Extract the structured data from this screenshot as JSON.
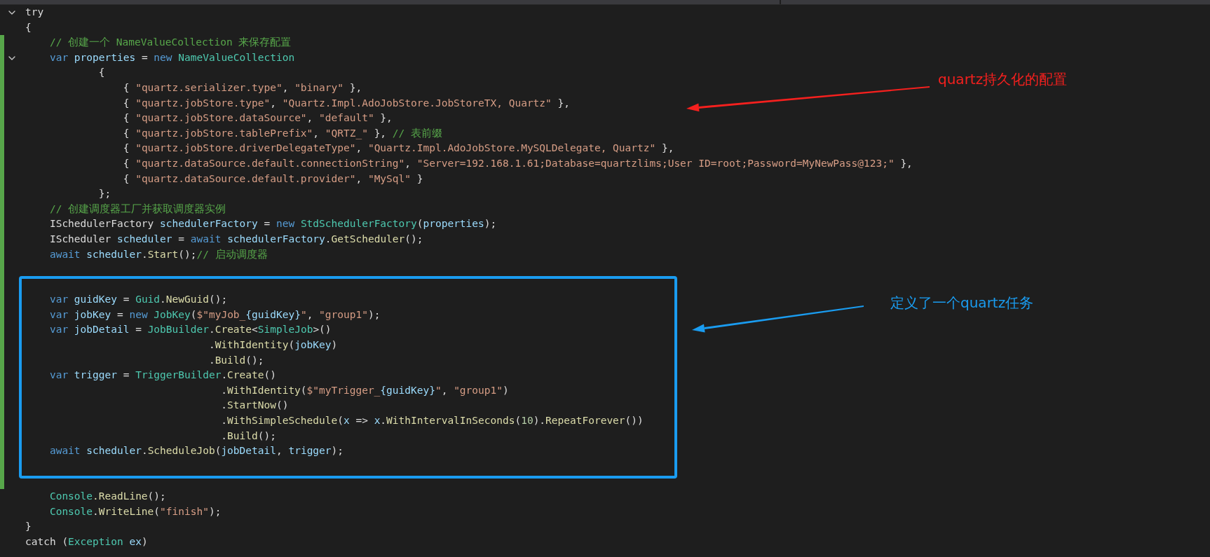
{
  "editor": {
    "lines": [
      {
        "foldable": true,
        "changed": false,
        "tokens": [
          {
            "kind": "plain",
            "text": "try"
          }
        ]
      },
      {
        "foldable": false,
        "changed": false,
        "tokens": [
          {
            "kind": "plain",
            "text": "{"
          }
        ]
      },
      {
        "foldable": false,
        "changed": true,
        "tokens": [
          {
            "kind": "comment",
            "text": "    // 创建一个 NameValueCollection 来保存配置"
          }
        ]
      },
      {
        "foldable": true,
        "changed": true,
        "tokens": [
          {
            "kind": "keyword",
            "text": "    var "
          },
          {
            "kind": "variable",
            "text": "properties"
          },
          {
            "kind": "plain",
            "text": " = "
          },
          {
            "kind": "keyword",
            "text": "new "
          },
          {
            "kind": "type",
            "text": "NameValueCollection"
          }
        ]
      },
      {
        "foldable": false,
        "changed": true,
        "tokens": [
          {
            "kind": "plain",
            "text": "            {"
          }
        ]
      },
      {
        "foldable": false,
        "changed": true,
        "tokens": [
          {
            "kind": "plain",
            "text": "                { "
          },
          {
            "kind": "string",
            "text": "\"quartz.serializer.type\""
          },
          {
            "kind": "plain",
            "text": ", "
          },
          {
            "kind": "string",
            "text": "\"binary\""
          },
          {
            "kind": "plain",
            "text": " },"
          }
        ]
      },
      {
        "foldable": false,
        "changed": true,
        "tokens": [
          {
            "kind": "plain",
            "text": "                { "
          },
          {
            "kind": "string",
            "text": "\"quartz.jobStore.type\""
          },
          {
            "kind": "plain",
            "text": ", "
          },
          {
            "kind": "string",
            "text": "\"Quartz.Impl.AdoJobStore.JobStoreTX, Quartz\""
          },
          {
            "kind": "plain",
            "text": " },"
          }
        ]
      },
      {
        "foldable": false,
        "changed": true,
        "tokens": [
          {
            "kind": "plain",
            "text": "                { "
          },
          {
            "kind": "string",
            "text": "\"quartz.jobStore.dataSource\""
          },
          {
            "kind": "plain",
            "text": ", "
          },
          {
            "kind": "string",
            "text": "\"default\""
          },
          {
            "kind": "plain",
            "text": " },"
          }
        ]
      },
      {
        "foldable": false,
        "changed": true,
        "tokens": [
          {
            "kind": "plain",
            "text": "                { "
          },
          {
            "kind": "string",
            "text": "\"quartz.jobStore.tablePrefix\""
          },
          {
            "kind": "plain",
            "text": ", "
          },
          {
            "kind": "string",
            "text": "\"QRTZ_\""
          },
          {
            "kind": "plain",
            "text": " }, "
          },
          {
            "kind": "comment",
            "text": "// 表前缀"
          }
        ]
      },
      {
        "foldable": false,
        "changed": true,
        "tokens": [
          {
            "kind": "plain",
            "text": "                { "
          },
          {
            "kind": "string",
            "text": "\"quartz.jobStore.driverDelegateType\""
          },
          {
            "kind": "plain",
            "text": ", "
          },
          {
            "kind": "string",
            "text": "\"Quartz.Impl.AdoJobStore.MySQLDelegate, Quartz\""
          },
          {
            "kind": "plain",
            "text": " },"
          }
        ]
      },
      {
        "foldable": false,
        "changed": true,
        "tokens": [
          {
            "kind": "plain",
            "text": "                { "
          },
          {
            "kind": "string",
            "text": "\"quartz.dataSource.default.connectionString\""
          },
          {
            "kind": "plain",
            "text": ", "
          },
          {
            "kind": "string",
            "text": "\"Server=192.168.1.61;Database=quartzlims;User ID=root;Password=MyNewPass@123;\""
          },
          {
            "kind": "plain",
            "text": " },"
          }
        ]
      },
      {
        "foldable": false,
        "changed": true,
        "tokens": [
          {
            "kind": "plain",
            "text": "                { "
          },
          {
            "kind": "string",
            "text": "\"quartz.dataSource.default.provider\""
          },
          {
            "kind": "plain",
            "text": ", "
          },
          {
            "kind": "string",
            "text": "\"MySql\""
          },
          {
            "kind": "plain",
            "text": " }"
          }
        ]
      },
      {
        "foldable": false,
        "changed": true,
        "tokens": [
          {
            "kind": "plain",
            "text": "            };"
          }
        ]
      },
      {
        "foldable": false,
        "changed": true,
        "tokens": [
          {
            "kind": "comment",
            "text": "    // 创建调度器工厂并获取调度器实例"
          }
        ]
      },
      {
        "foldable": false,
        "changed": true,
        "tokens": [
          {
            "kind": "plain",
            "text": "    ISchedulerFactory "
          },
          {
            "kind": "variable",
            "text": "schedulerFactory"
          },
          {
            "kind": "plain",
            "text": " = "
          },
          {
            "kind": "keyword",
            "text": "new "
          },
          {
            "kind": "type",
            "text": "StdSchedulerFactory"
          },
          {
            "kind": "plain",
            "text": "("
          },
          {
            "kind": "variable",
            "text": "properties"
          },
          {
            "kind": "plain",
            "text": ");"
          }
        ]
      },
      {
        "foldable": false,
        "changed": true,
        "tokens": [
          {
            "kind": "plain",
            "text": "    IScheduler "
          },
          {
            "kind": "variable",
            "text": "scheduler"
          },
          {
            "kind": "plain",
            "text": " = "
          },
          {
            "kind": "keyword",
            "text": "await "
          },
          {
            "kind": "variable",
            "text": "schedulerFactory"
          },
          {
            "kind": "plain",
            "text": "."
          },
          {
            "kind": "method",
            "text": "GetScheduler"
          },
          {
            "kind": "plain",
            "text": "();"
          }
        ]
      },
      {
        "foldable": false,
        "changed": true,
        "tokens": [
          {
            "kind": "keyword",
            "text": "    await "
          },
          {
            "kind": "variable",
            "text": "scheduler"
          },
          {
            "kind": "plain",
            "text": "."
          },
          {
            "kind": "method",
            "text": "Start"
          },
          {
            "kind": "plain",
            "text": "();"
          },
          {
            "kind": "comment",
            "text": "// 启动调度器"
          }
        ]
      },
      {
        "foldable": false,
        "changed": true
      },
      {
        "foldable": false,
        "changed": true
      },
      {
        "foldable": false,
        "changed": true,
        "tokens": [
          {
            "kind": "keyword",
            "text": "    var "
          },
          {
            "kind": "variable",
            "text": "guidKey"
          },
          {
            "kind": "plain",
            "text": " = "
          },
          {
            "kind": "type",
            "text": "Guid"
          },
          {
            "kind": "plain",
            "text": "."
          },
          {
            "kind": "method",
            "text": "NewGuid"
          },
          {
            "kind": "plain",
            "text": "();"
          }
        ]
      },
      {
        "foldable": false,
        "changed": true,
        "tokens": [
          {
            "kind": "keyword",
            "text": "    var "
          },
          {
            "kind": "variable",
            "text": "jobKey"
          },
          {
            "kind": "plain",
            "text": " = "
          },
          {
            "kind": "keyword",
            "text": "new "
          },
          {
            "kind": "type",
            "text": "JobKey"
          },
          {
            "kind": "plain",
            "text": "("
          },
          {
            "kind": "string",
            "text": "$\"myJob_"
          },
          {
            "kind": "variable",
            "text": "{guidKey}"
          },
          {
            "kind": "string",
            "text": "\""
          },
          {
            "kind": "plain",
            "text": ", "
          },
          {
            "kind": "string",
            "text": "\"group1\""
          },
          {
            "kind": "plain",
            "text": ");"
          }
        ]
      },
      {
        "foldable": false,
        "changed": true,
        "tokens": [
          {
            "kind": "keyword",
            "text": "    var "
          },
          {
            "kind": "variable",
            "text": "jobDetail"
          },
          {
            "kind": "plain",
            "text": " = "
          },
          {
            "kind": "type",
            "text": "JobBuilder"
          },
          {
            "kind": "plain",
            "text": "."
          },
          {
            "kind": "method",
            "text": "Create"
          },
          {
            "kind": "plain",
            "text": "<"
          },
          {
            "kind": "type",
            "text": "SimpleJob"
          },
          {
            "kind": "plain",
            "text": ">()"
          }
        ]
      },
      {
        "foldable": false,
        "changed": true,
        "tokens": [
          {
            "kind": "plain",
            "text": "                              ."
          },
          {
            "kind": "method",
            "text": "WithIdentity"
          },
          {
            "kind": "plain",
            "text": "("
          },
          {
            "kind": "variable",
            "text": "jobKey"
          },
          {
            "kind": "plain",
            "text": ")"
          }
        ]
      },
      {
        "foldable": false,
        "changed": true,
        "tokens": [
          {
            "kind": "plain",
            "text": "                              ."
          },
          {
            "kind": "method",
            "text": "Build"
          },
          {
            "kind": "plain",
            "text": "();"
          }
        ]
      },
      {
        "foldable": false,
        "changed": true,
        "tokens": [
          {
            "kind": "keyword",
            "text": "    var "
          },
          {
            "kind": "variable",
            "text": "trigger"
          },
          {
            "kind": "plain",
            "text": " = "
          },
          {
            "kind": "type",
            "text": "TriggerBuilder"
          },
          {
            "kind": "plain",
            "text": "."
          },
          {
            "kind": "method",
            "text": "Create"
          },
          {
            "kind": "plain",
            "text": "()"
          }
        ]
      },
      {
        "foldable": false,
        "changed": true,
        "tokens": [
          {
            "kind": "plain",
            "text": "                                ."
          },
          {
            "kind": "method",
            "text": "WithIdentity"
          },
          {
            "kind": "plain",
            "text": "("
          },
          {
            "kind": "string",
            "text": "$\"myTrigger_"
          },
          {
            "kind": "variable",
            "text": "{guidKey}"
          },
          {
            "kind": "string",
            "text": "\""
          },
          {
            "kind": "plain",
            "text": ", "
          },
          {
            "kind": "string",
            "text": "\"group1\""
          },
          {
            "kind": "plain",
            "text": ")"
          }
        ]
      },
      {
        "foldable": false,
        "changed": true,
        "tokens": [
          {
            "kind": "plain",
            "text": "                                ."
          },
          {
            "kind": "method",
            "text": "StartNow"
          },
          {
            "kind": "plain",
            "text": "()"
          }
        ]
      },
      {
        "foldable": false,
        "changed": true,
        "tokens": [
          {
            "kind": "plain",
            "text": "                                ."
          },
          {
            "kind": "method",
            "text": "WithSimpleSchedule"
          },
          {
            "kind": "plain",
            "text": "("
          },
          {
            "kind": "variable",
            "text": "x"
          },
          {
            "kind": "plain",
            "text": " => "
          },
          {
            "kind": "variable",
            "text": "x"
          },
          {
            "kind": "plain",
            "text": "."
          },
          {
            "kind": "method",
            "text": "WithIntervalInSeconds"
          },
          {
            "kind": "plain",
            "text": "("
          },
          {
            "kind": "number",
            "text": "10"
          },
          {
            "kind": "plain",
            "text": ")."
          },
          {
            "kind": "method",
            "text": "RepeatForever"
          },
          {
            "kind": "plain",
            "text": "())"
          }
        ]
      },
      {
        "foldable": false,
        "changed": true,
        "tokens": [
          {
            "kind": "plain",
            "text": "                                ."
          },
          {
            "kind": "method",
            "text": "Build"
          },
          {
            "kind": "plain",
            "text": "();"
          }
        ]
      },
      {
        "foldable": false,
        "changed": true,
        "tokens": [
          {
            "kind": "keyword",
            "text": "    await "
          },
          {
            "kind": "variable",
            "text": "scheduler"
          },
          {
            "kind": "plain",
            "text": "."
          },
          {
            "kind": "method",
            "text": "ScheduleJob"
          },
          {
            "kind": "plain",
            "text": "("
          },
          {
            "kind": "variable",
            "text": "jobDetail"
          },
          {
            "kind": "plain",
            "text": ", "
          },
          {
            "kind": "variable",
            "text": "trigger"
          },
          {
            "kind": "plain",
            "text": ");"
          }
        ]
      },
      {
        "foldable": false,
        "changed": true
      },
      {
        "foldable": false,
        "changed": true
      },
      {
        "foldable": false,
        "changed": false,
        "tokens": [
          {
            "kind": "type",
            "text": "    Console"
          },
          {
            "kind": "method",
            "text": ".ReadLine"
          },
          {
            "kind": "plain",
            "text": "();"
          }
        ]
      },
      {
        "foldable": false,
        "changed": false,
        "tokens": [
          {
            "kind": "type",
            "text": "    Console"
          },
          {
            "kind": "plain",
            "text": "."
          },
          {
            "kind": "method",
            "text": "WriteLine"
          },
          {
            "kind": "plain",
            "text": "("
          },
          {
            "kind": "string",
            "text": "\"finish\""
          },
          {
            "kind": "plain",
            "text": ");"
          }
        ]
      },
      {
        "foldable": false,
        "changed": false,
        "tokens": [
          {
            "kind": "plain",
            "text": "}"
          }
        ]
      },
      {
        "foldable": false,
        "changed": false,
        "tokens": [
          {
            "kind": "plain",
            "text": "catch ("
          },
          {
            "kind": "type",
            "text": "Exception "
          },
          {
            "kind": "variable",
            "text": "ex"
          },
          {
            "kind": "plain",
            "text": ")"
          }
        ]
      }
    ]
  },
  "annotations": [
    {
      "text": "quartz持久化的配置",
      "color": "#f5201e",
      "boxed": false
    },
    {
      "text": "定义了一个quartz任务",
      "color": "#1a9cf0",
      "boxed": true
    }
  ]
}
